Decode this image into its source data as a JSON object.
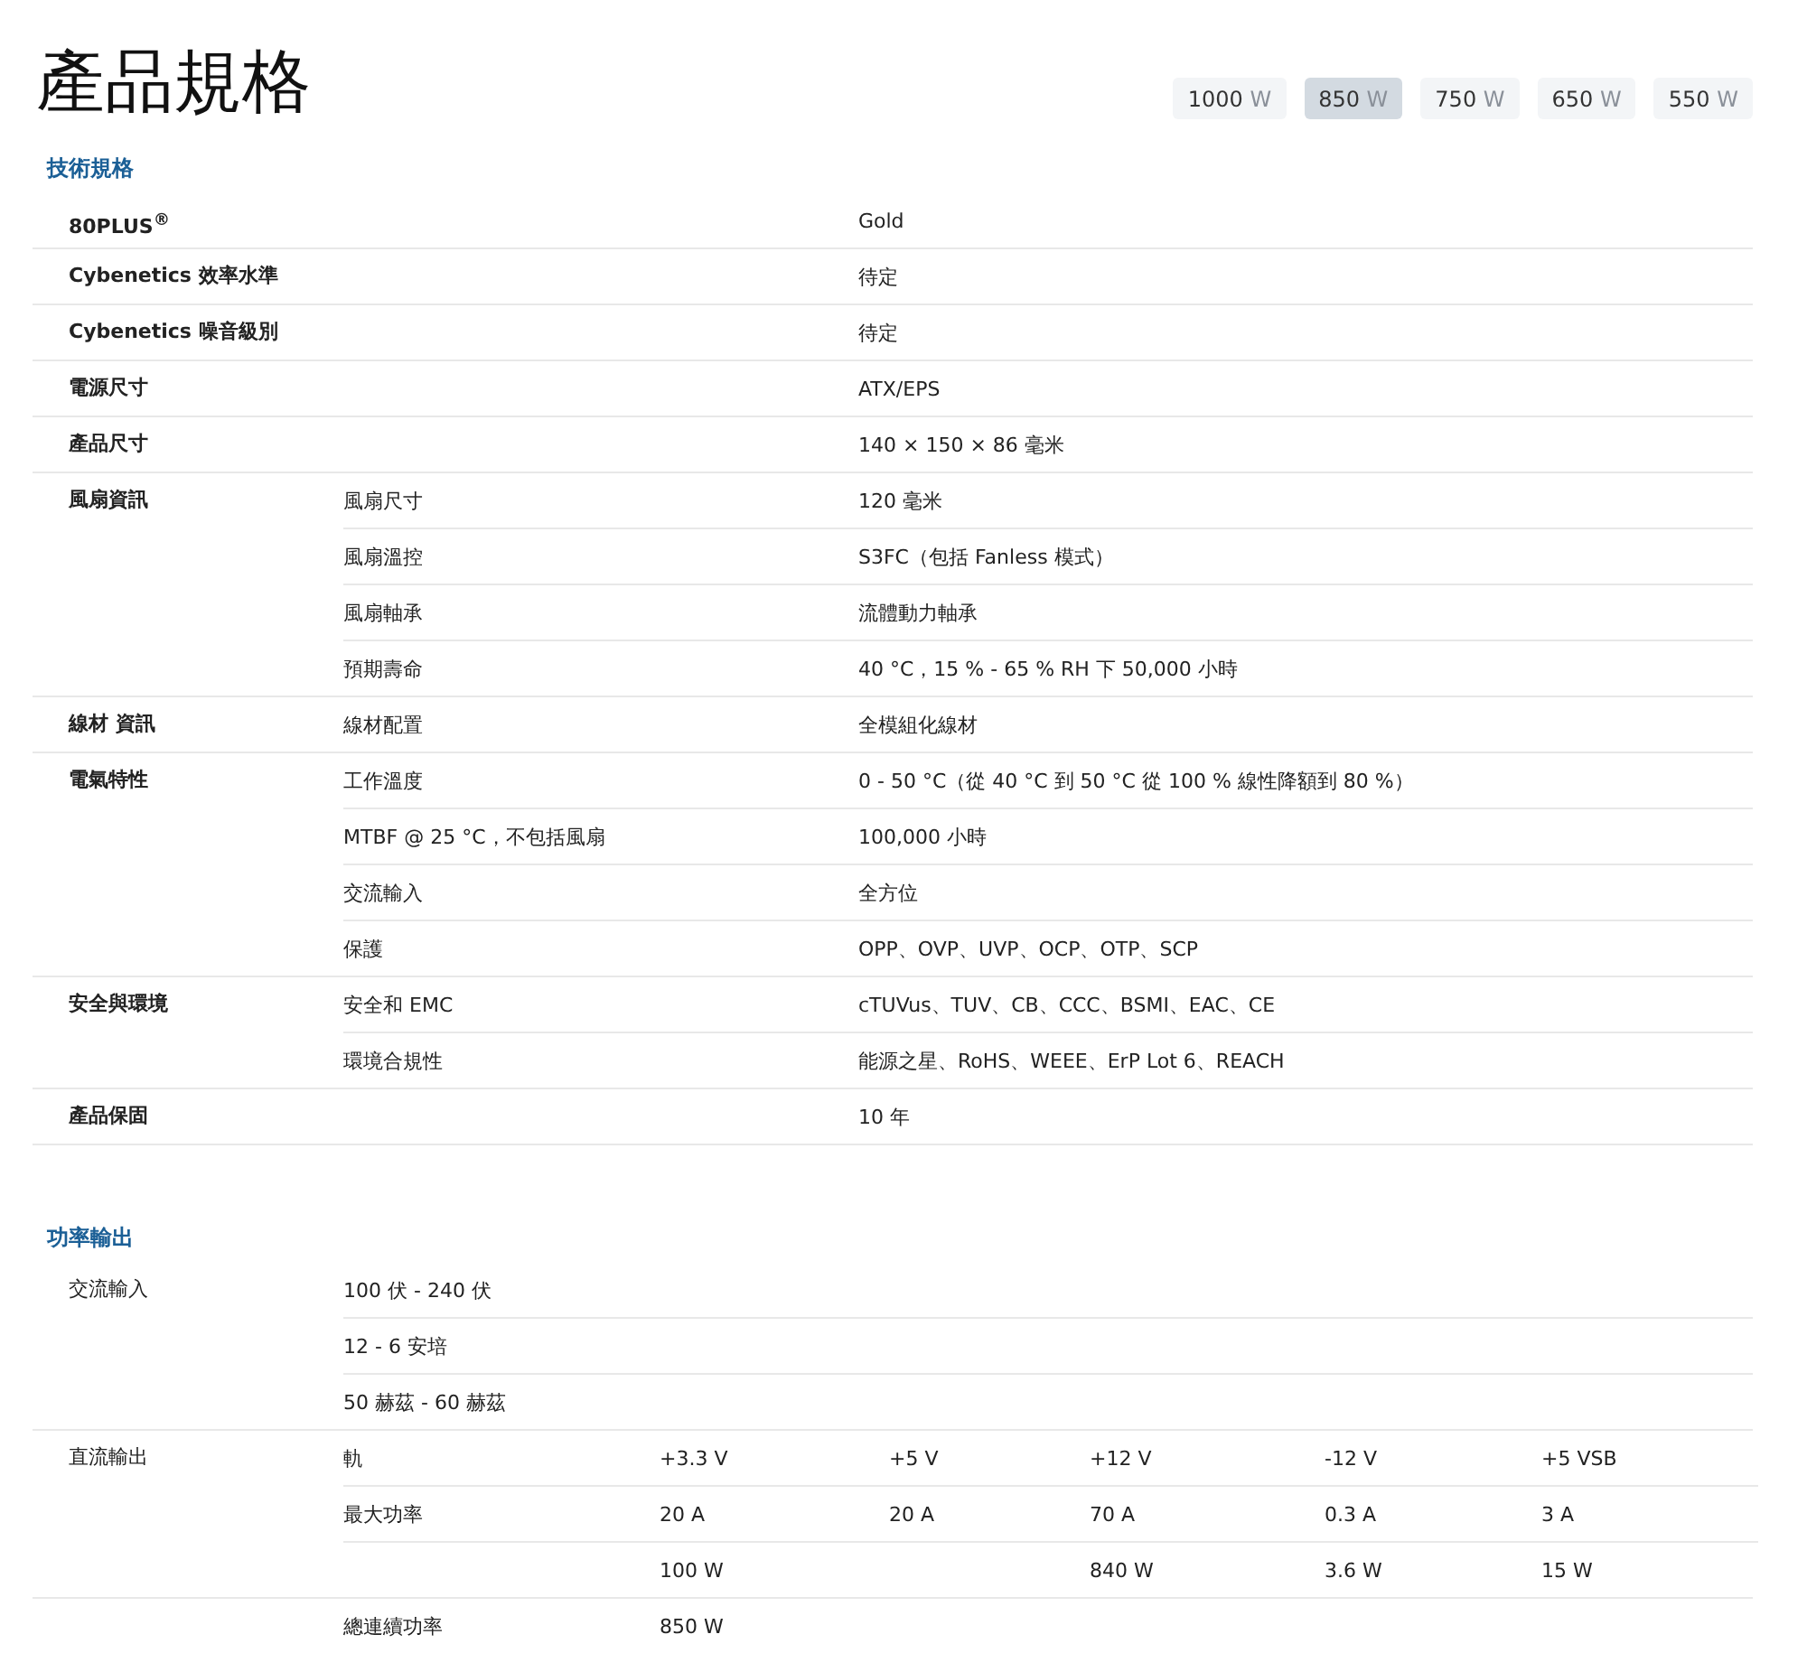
{
  "title": "產品規格",
  "wattage_tabs": [
    {
      "value": "1000",
      "unit": "W",
      "selected": false
    },
    {
      "value": "850",
      "unit": "W",
      "selected": true
    },
    {
      "value": "750",
      "unit": "W",
      "selected": false
    },
    {
      "value": "650",
      "unit": "W",
      "selected": false
    },
    {
      "value": "550",
      "unit": "W",
      "selected": false
    }
  ],
  "technical_specs": {
    "heading": "技術規格",
    "groups": [
      {
        "label": "80PLUS$^{®}$",
        "rows": [
          {
            "value": "Gold"
          }
        ]
      },
      {
        "label": "Cybenetics 效率水準",
        "rows": [
          {
            "value": "待定"
          }
        ]
      },
      {
        "label": "Cybenetics 噪音級別",
        "rows": [
          {
            "value": "待定"
          }
        ]
      },
      {
        "label": "電源尺寸",
        "rows": [
          {
            "value": "ATX/EPS"
          }
        ]
      },
      {
        "label": "產品尺寸",
        "rows": [
          {
            "value": "140 × 150 × 86 毫米"
          }
        ]
      },
      {
        "label": "風扇資訊",
        "rows": [
          {
            "label": "風扇尺寸",
            "value": "120 毫米"
          },
          {
            "label": "風扇溫控",
            "value": "S3FC（包括 Fanless 模式）"
          },
          {
            "label": "風扇軸承",
            "value": "流體動力軸承"
          },
          {
            "label": "預期壽命",
            "value": "40 °C，15 % - 65 % RH 下 50,000 小時"
          }
        ]
      },
      {
        "label": "線材 資訊",
        "rows": [
          {
            "label": "線材配置",
            "value": "全模組化線材"
          }
        ]
      },
      {
        "label": "電氣特性",
        "rows": [
          {
            "label": "工作溫度",
            "value": "0 - 50 °C（從 40 °C 到 50 °C 從 100 % 線性降額到 80 %）"
          },
          {
            "label": "MTBF @ 25 °C，不包括風扇",
            "value": "100,000 小時"
          },
          {
            "label": "交流輸入",
            "value": "全方位"
          },
          {
            "label": "保護",
            "value": "OPP、OVP、UVP、OCP、OTP、SCP"
          }
        ]
      },
      {
        "label": "安全與環境",
        "rows": [
          {
            "label": "安全和 EMC",
            "value": "cTUVus、TUV、CB、CCC、BSMI、EAC、CE"
          },
          {
            "label": "環境合規性",
            "value": "能源之星、RoHS、WEEE、ErP Lot 6、REACH"
          }
        ]
      },
      {
        "label": "產品保固",
        "rows": [
          {
            "value": "10 年"
          }
        ]
      }
    ]
  },
  "power_output": {
    "heading": "功率輸出",
    "groups": [
      {
        "label": "交流輸入",
        "rows": [
          {
            "label": "100 伏 - 240 伏"
          },
          {
            "label": "12 - 6 安培"
          },
          {
            "label": "50 赫茲 - 60 赫茲"
          }
        ]
      },
      {
        "label": "直流輸出",
        "rows": [
          {
            "label": "軌",
            "cells": [
              "+3.3 V",
              "+5 V",
              "+12 V",
              "-12 V",
              "+5 VSB"
            ]
          },
          {
            "label": "最大功率",
            "cells": [
              "20 A",
              "20 A",
              "70 A",
              "0.3 A",
              "3 A"
            ]
          },
          {
            "cells": [
              "100 W",
              null,
              "840 W",
              "3.6 W",
              "15 W"
            ]
          }
        ]
      },
      {
        "rows": [
          {
            "label": "總連續功率",
            "cells": [
              "850 W"
            ]
          }
        ]
      }
    ]
  }
}
